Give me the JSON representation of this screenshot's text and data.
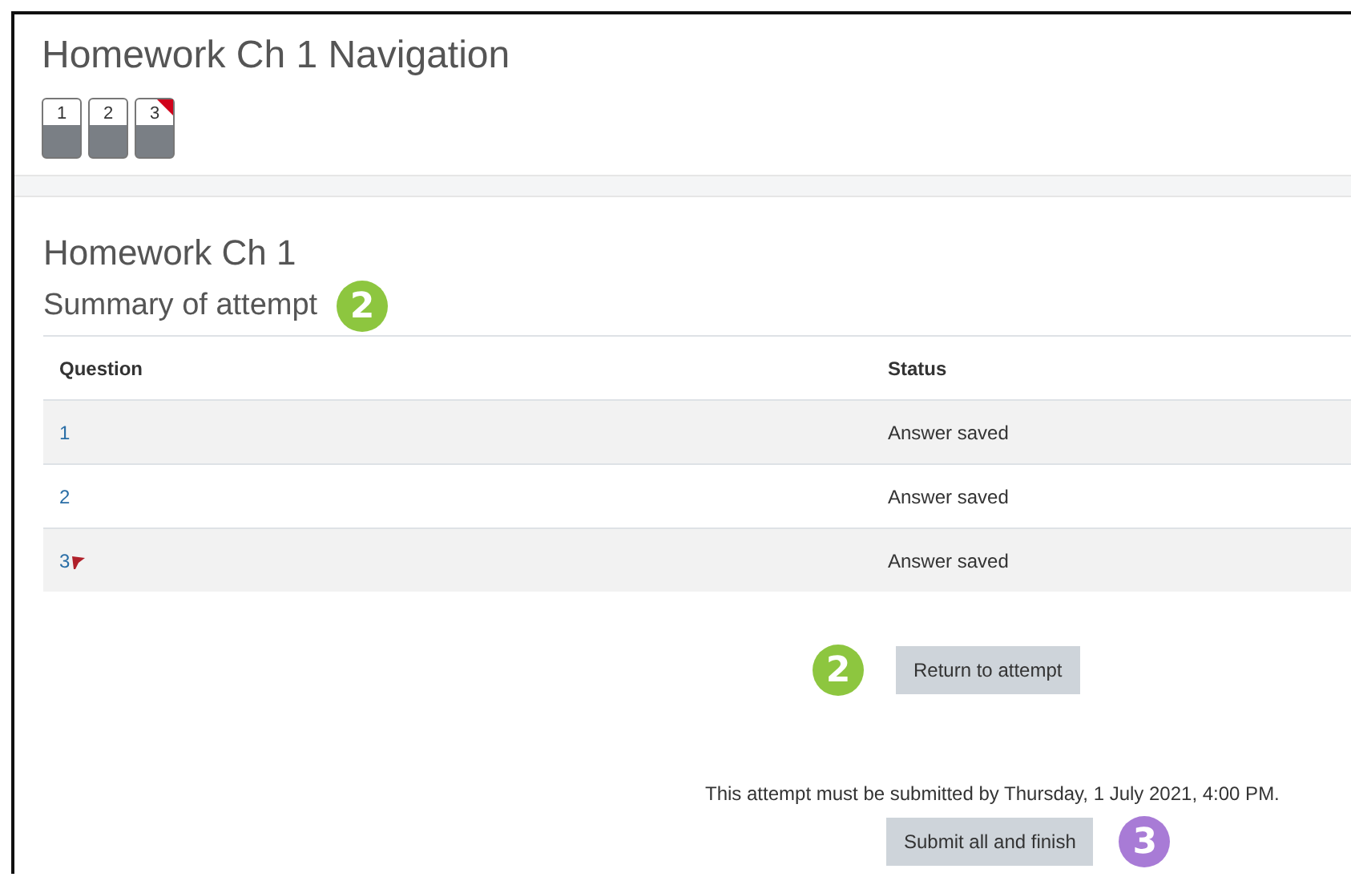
{
  "navigation": {
    "title": "Homework Ch 1 Navigation",
    "buttons": [
      {
        "label": "1",
        "flagged": false
      },
      {
        "label": "2",
        "flagged": false
      },
      {
        "label": "3",
        "flagged": true
      }
    ]
  },
  "summary": {
    "heading": "Homework Ch 1",
    "subheading": "Summary of attempt",
    "callout": {
      "label": "2",
      "color": "#8dc63f"
    },
    "columns": [
      "Question",
      "Status"
    ],
    "rows": [
      {
        "question": "1",
        "status": "Answer saved",
        "flagged": false
      },
      {
        "question": "2",
        "status": "Answer saved",
        "flagged": false
      },
      {
        "question": "3",
        "status": "Answer saved",
        "flagged": true
      }
    ]
  },
  "return": {
    "button": "Return to attempt",
    "callout": {
      "label": "2",
      "color": "#8dc63f"
    }
  },
  "submit": {
    "deadline": "This attempt must be submitted by Thursday, 1 July 2021, 4:00 PM.",
    "button": "Submit all and finish",
    "callout": {
      "label": "3",
      "color": "#a87bd6"
    }
  }
}
